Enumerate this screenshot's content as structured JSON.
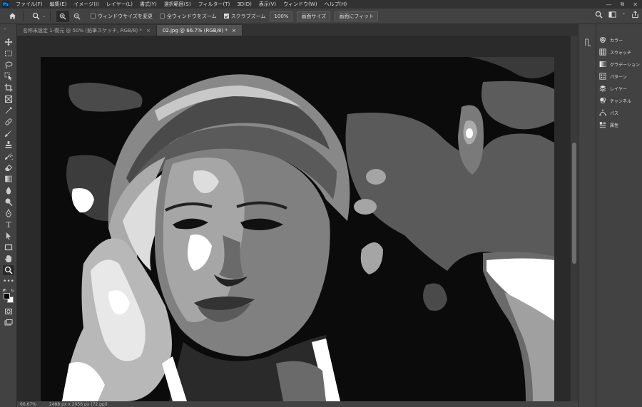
{
  "app": {
    "logo_text": "Ps"
  },
  "menubar": {
    "items": [
      "ファイル(F)",
      "編集(E)",
      "イメージ(I)",
      "レイヤー(L)",
      "書式(Y)",
      "選択範囲(S)",
      "フィルター(T)",
      "3D(D)",
      "表示(V)",
      "ウィンドウ(W)",
      "ヘルプ(H)"
    ],
    "window_controls": [
      "—",
      "⧉",
      "✕"
    ]
  },
  "options": {
    "resize_windows_label": "ウィンドウサイズを変更",
    "resize_windows_checked": false,
    "zoom_all_label": "全ウィンドウをズーム",
    "zoom_all_checked": false,
    "scrubby_zoom_label": "スクラブズーム",
    "scrubby_zoom_checked": true,
    "zoom_100_label": "100%",
    "fit_screen_label": "画面サイズ",
    "fill_screen_label": "画面にフィット"
  },
  "tabs": [
    {
      "title": "名称未設定 1-復元 @ 50% (鉛筆スケッチ, RGB/8) *",
      "close": "×",
      "active": false
    },
    {
      "title": "02.jpg @ 66.7% (RGB/8) *",
      "close": "×",
      "active": true
    }
  ],
  "statusbar": {
    "zoom": "66.67%",
    "doc_info": "2488 px x 2056 px (72 ppi)"
  },
  "panels": [
    {
      "label": "カラー",
      "icon": "color-wheel-icon"
    },
    {
      "label": "スウォッチ",
      "icon": "swatches-grid-icon"
    },
    {
      "label": "グラデーション",
      "icon": "gradient-icon"
    },
    {
      "label": "パターン",
      "icon": "pattern-icon"
    },
    {
      "label": "レイヤー",
      "icon": "layers-icon"
    },
    {
      "label": "チャンネル",
      "icon": "channels-icon"
    },
    {
      "label": "パス",
      "icon": "paths-icon"
    },
    {
      "label": "属性",
      "icon": "properties-icon"
    }
  ],
  "colors": {
    "menubar_bg": "#323232",
    "panel_bg": "#424242",
    "workspace_bg": "#2a2a2a",
    "accent": "#31a8ff"
  }
}
